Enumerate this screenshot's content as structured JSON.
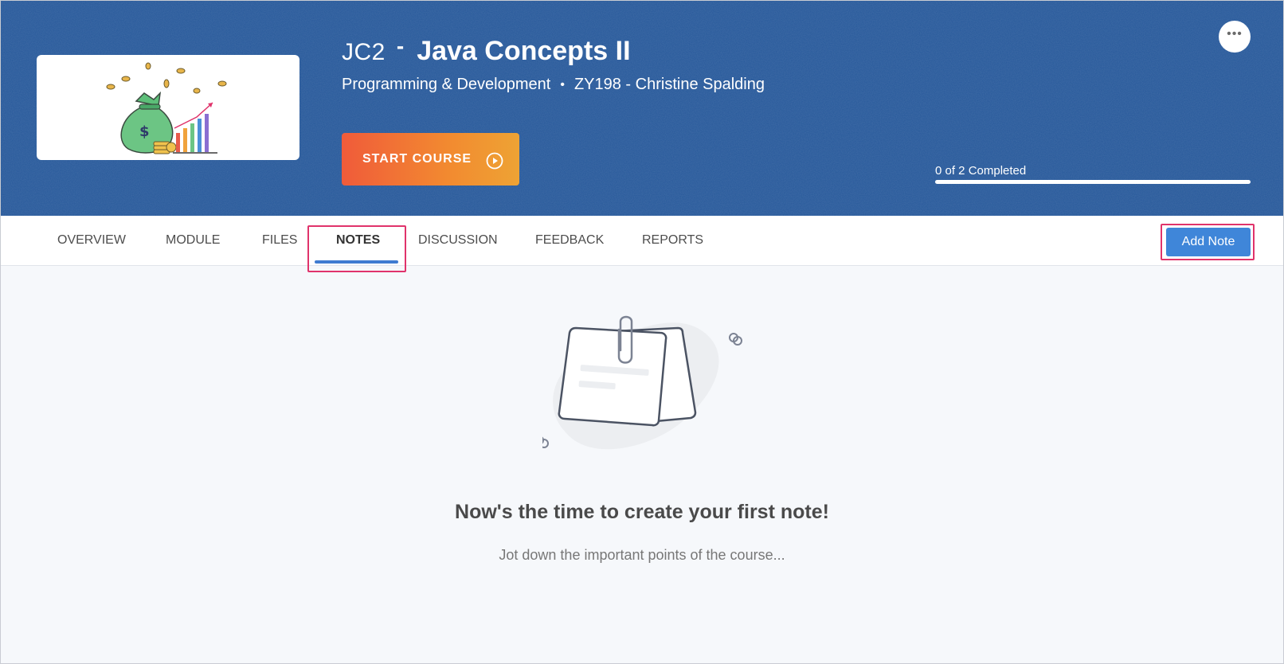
{
  "header": {
    "course_code": "JC2",
    "separator": "-",
    "course_title": "Java Concepts II",
    "category": "Programming & Development",
    "meta_separator": "•",
    "instructor_line": "ZY198 - Christine Spalding",
    "start_button_label": "START COURSE",
    "more_icon": "more-horizontal-icon",
    "more_label": "•••",
    "progress": {
      "label": "0 of 2 Completed",
      "completed": 0,
      "total": 2
    },
    "thumbnail_icon": "money-bag-growth-icon"
  },
  "tabs": [
    {
      "label": "OVERVIEW",
      "active": false
    },
    {
      "label": "MODULE",
      "active": false
    },
    {
      "label": "FILES",
      "active": false
    },
    {
      "label": "NOTES",
      "active": true
    },
    {
      "label": "DISCUSSION",
      "active": false
    },
    {
      "label": "FEEDBACK",
      "active": false
    },
    {
      "label": "REPORTS",
      "active": false
    }
  ],
  "toolbar": {
    "add_note_label": "Add Note"
  },
  "empty_state": {
    "icon": "notes-clip-icon",
    "title": "Now's the time to create your first note!",
    "subtitle": "Jot down the important points of the course..."
  },
  "colors": {
    "banner": "#26589a",
    "start_gradient_from": "#f05b3a",
    "start_gradient_to": "#eea334",
    "accent": "#3f86d9",
    "highlight": "#e0336b"
  }
}
